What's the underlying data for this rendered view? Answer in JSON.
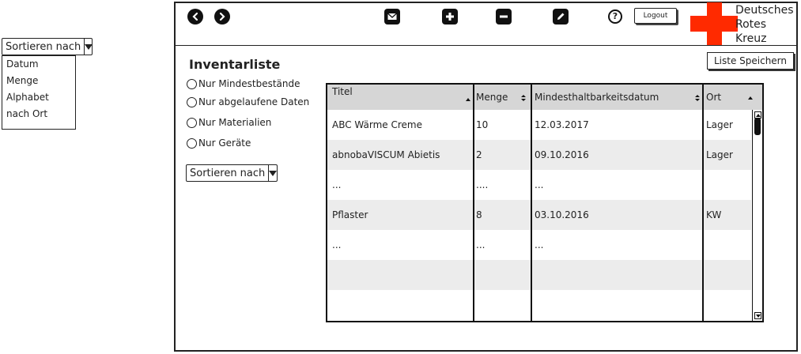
{
  "side_dropdown": {
    "label": "Sortieren nach",
    "options": [
      "Datum",
      "Menge",
      "Alphabet",
      "nach Ort"
    ]
  },
  "toolbar": {
    "back_icon": "back-icon",
    "forward_icon": "forward-icon",
    "mail_icon": "mail-icon",
    "add_icon": "plus-icon",
    "remove_icon": "minus-icon",
    "edit_icon": "pencil-icon",
    "help": "?",
    "logout": "Logout"
  },
  "brand": {
    "line1": "Deutsches",
    "line2": "Rotes",
    "line3": "Kreuz",
    "color": "#ff2a00"
  },
  "page": {
    "title": "Inventarliste",
    "save_button": "Liste Speichern",
    "filters": [
      "Nur Mindestbestände",
      "Nur abgelaufene Daten",
      "Nur Materialien",
      "Nur Geräte"
    ],
    "sort_label": "Sortieren nach"
  },
  "table": {
    "headers": [
      "Titel",
      "Menge",
      "Mindesthaltbarkeitsdatum",
      "Ort"
    ],
    "rows": [
      [
        "ABC Wärme Creme",
        "10",
        "12.03.2017",
        "Lager"
      ],
      [
        "abnobaVISCUM Abietis",
        "2",
        "09.10.2016",
        "Lager"
      ],
      [
        "...",
        "....",
        "...",
        ""
      ],
      [
        "Pflaster",
        "8",
        "03.10.2016",
        "KW"
      ],
      [
        "...",
        "...",
        "...",
        ""
      ],
      [
        "",
        "",
        "",
        ""
      ],
      [
        "",
        "",
        "",
        ""
      ]
    ]
  }
}
